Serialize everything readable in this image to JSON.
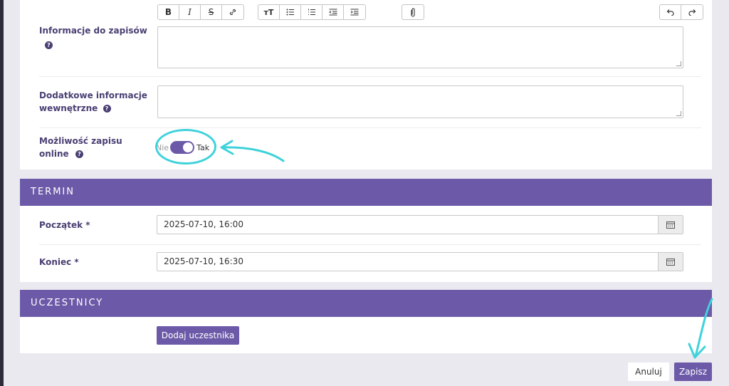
{
  "form": {
    "info_label": "Informacje do zapisów",
    "extra_label_line1": "Dodatkowe informacje",
    "extra_label_line2": "wewnętrzne",
    "online_label_line1": "Możliwość zapisu",
    "online_label_line2": "online",
    "help_glyph": "?",
    "toggle": {
      "off_label": "Nie",
      "on_label": "Tak",
      "state": "on"
    }
  },
  "toolbar": {
    "bold": "B",
    "italic": "I",
    "strike": "S",
    "link_icon": "link-icon",
    "text_size": "тT",
    "bullet_icon": "bullet-list-icon",
    "numbered_icon": "numbered-list-icon",
    "outdent_icon": "outdent-icon",
    "indent_icon": "indent-icon",
    "attach_icon": "paperclip-icon",
    "undo_icon": "undo-icon",
    "redo_icon": "redo-icon"
  },
  "termin": {
    "heading": "TERMIN",
    "start_label": "Początek *",
    "start_value": "2025-07-10, 16:00",
    "end_label": "Koniec *",
    "end_value": "2025-07-10, 16:30"
  },
  "uczestnicy": {
    "heading": "UCZESTNICY",
    "add_button": "Dodaj uczestnika"
  },
  "footer": {
    "cancel": "Anuluj",
    "save": "Zapisz"
  },
  "colors": {
    "accent": "#6c5aa8",
    "annotation": "#3fd2db"
  }
}
